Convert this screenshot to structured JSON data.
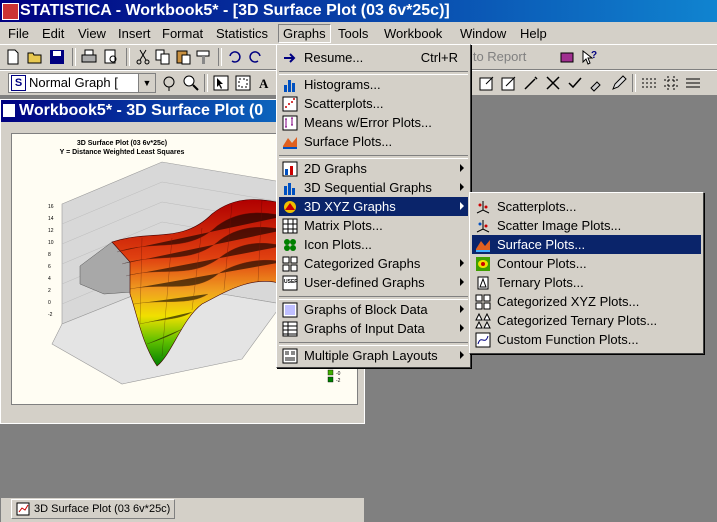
{
  "window": {
    "title": "STATISTICA - Workbook5* - [3D Surface Plot (03 6v*25c)]"
  },
  "menubar": [
    {
      "label": "File"
    },
    {
      "label": "Edit"
    },
    {
      "label": "View"
    },
    {
      "label": "Insert"
    },
    {
      "label": "Format"
    },
    {
      "label": "Statistics"
    },
    {
      "label": "Graphs"
    },
    {
      "label": "Tools"
    },
    {
      "label": "Workbook"
    },
    {
      "label": "Window"
    },
    {
      "label": "Help"
    }
  ],
  "toolbar": {
    "graph_style_value": "Normal Graph [",
    "report_label": "d to Report"
  },
  "workbook": {
    "title": "Workbook5* - 3D Surface Plot (0",
    "tab_label": "3D Surface Plot (03 6v*25c)"
  },
  "graph": {
    "title": "3D Surface Plot (03 6v*25c)",
    "subtitle": "Y = Distance Weighted Least Squares",
    "z_ticks": [
      "16",
      "14",
      "12",
      "10",
      "8",
      "6",
      "4",
      "2",
      "0",
      "-2"
    ],
    "legend": [
      "-0",
      "-2"
    ],
    "colors": {
      "high": "#b00000",
      "mid": "#e87020",
      "low": "#f0e000",
      "lower": "#40b000",
      "bottom": "#008000"
    }
  },
  "graphs_menu": {
    "items": [
      {
        "label": "Resume...",
        "shortcut": "Ctrl+R",
        "icon": "resume-icon"
      },
      {
        "label": "Histograms...",
        "icon": "histogram-icon"
      },
      {
        "label": "Scatterplots...",
        "icon": "scatterplot-icon"
      },
      {
        "label": "Means w/Error Plots...",
        "icon": "means-icon"
      },
      {
        "label": "Surface Plots...",
        "icon": "surface-icon"
      },
      {
        "label": "2D Graphs",
        "icon": "2d-graphs-icon"
      },
      {
        "label": "3D Sequential Graphs",
        "icon": "3d-sequential-icon"
      },
      {
        "label": "3D XYZ Graphs",
        "icon": "3d-xyz-icon"
      },
      {
        "label": "Matrix Plots...",
        "icon": "matrix-icon"
      },
      {
        "label": "Icon Plots...",
        "icon": "icon-plots-icon"
      },
      {
        "label": "Categorized Graphs",
        "icon": "categorized-icon"
      },
      {
        "label": "User-defined Graphs",
        "icon": "user-defined-icon"
      },
      {
        "label": "Graphs of Block Data",
        "icon": "block-data-icon"
      },
      {
        "label": "Graphs of Input Data",
        "icon": "input-data-icon"
      },
      {
        "label": "Multiple Graph Layouts",
        "icon": "multiple-layouts-icon"
      }
    ]
  },
  "xyz_submenu": {
    "items": [
      {
        "label": "Scatterplots...",
        "icon": "3d-scatter-icon"
      },
      {
        "label": "Scatter Image Plots...",
        "icon": "scatter-image-icon"
      },
      {
        "label": "Surface Plots...",
        "icon": "3d-surface-icon"
      },
      {
        "label": "Contour Plots...",
        "icon": "contour-icon"
      },
      {
        "label": "Ternary Plots...",
        "icon": "ternary-icon"
      },
      {
        "label": "Categorized XYZ Plots...",
        "icon": "categorized-xyz-icon"
      },
      {
        "label": "Categorized Ternary Plots...",
        "icon": "categorized-ternary-icon"
      },
      {
        "label": "Custom Function Plots...",
        "icon": "custom-function-icon"
      }
    ]
  }
}
